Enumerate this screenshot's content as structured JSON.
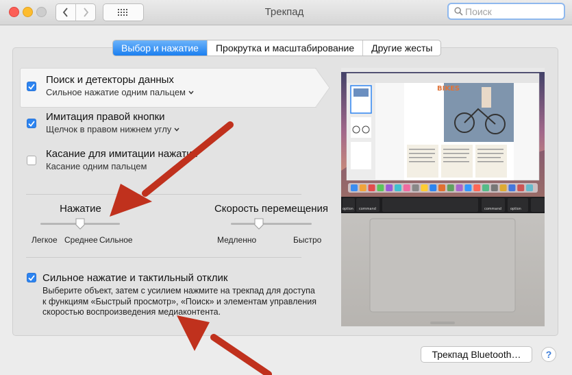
{
  "window": {
    "title": "Трекпад"
  },
  "search": {
    "placeholder": "Поиск"
  },
  "tabs": [
    {
      "label": "Выбор и нажатие",
      "active": true
    },
    {
      "label": "Прокрутка и масштабирование",
      "active": false
    },
    {
      "label": "Другие жесты",
      "active": false
    }
  ],
  "options": [
    {
      "title": "Поиск и детекторы данных",
      "subtitle": "Сильное нажатие одним пальцем",
      "checked": true,
      "has_menu": true
    },
    {
      "title": "Имитация правой кнопки",
      "subtitle": "Щелчок в правом нижнем углу",
      "checked": true,
      "has_menu": true
    },
    {
      "title": "Касание для имитации нажатия",
      "subtitle": "Касание одним пальцем",
      "checked": false,
      "has_menu": false
    }
  ],
  "sliders": {
    "click": {
      "label": "Нажатие",
      "ticks": [
        "Легкое",
        "Среднее",
        "Сильное"
      ],
      "level": 0.5
    },
    "tracking": {
      "label": "Скорость перемещения",
      "min_label": "Медленно",
      "max_label": "Быстро",
      "level": 0.35
    }
  },
  "force_click": {
    "title": "Сильное нажатие и тактильный отклик",
    "checked": true,
    "description": "Выберите объект, затем с усилием нажмите на трекпад для доступа к функциям «Быстрый просмотр», «Поиск» и элементам управления скоростью воспроизведения медиаконтента."
  },
  "preview": {
    "doc_title": "BIKES",
    "keys": [
      "option",
      "command",
      "command",
      "option"
    ]
  },
  "footer": {
    "bluetooth_button": "Трекпад Bluetooth…",
    "help": "?"
  },
  "colors": {
    "accent": "#2d84f0",
    "arrow": "#c0311d"
  }
}
